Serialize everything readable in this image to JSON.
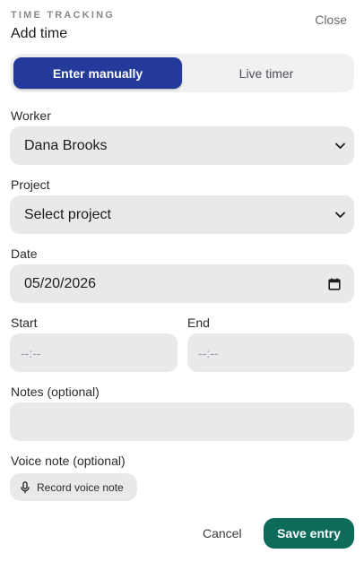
{
  "header": {
    "eyebrow": "TIME TRACKING",
    "title": "Add time",
    "close_label": "Close"
  },
  "mode_tabs": [
    {
      "label": "Enter manually",
      "active": true
    },
    {
      "label": "Live timer",
      "active": false
    }
  ],
  "form": {
    "worker": {
      "label": "Worker",
      "value": "Dana Brooks"
    },
    "project": {
      "label": "Project",
      "value": "Select project"
    },
    "date": {
      "label": "Date",
      "value": "05/20/2026"
    },
    "start": {
      "label": "Start",
      "value": "--:--"
    },
    "end": {
      "label": "End",
      "value": "--:--"
    },
    "notes": {
      "label": "Notes (optional)",
      "value": ""
    },
    "voice_note": {
      "label": "Voice note (optional)",
      "button_label": "Record voice note"
    }
  },
  "actions": {
    "cancel_label": "Cancel",
    "save_label": "Save entry"
  },
  "colors": {
    "active_tab": "#233a9b",
    "save_button": "#0d6b5a",
    "field_bg": "#e9e9eb"
  },
  "icons": {
    "worker_select": "chevron-down-icon",
    "project_select": "chevron-down-icon",
    "date_picker": "calendar-icon",
    "voice": "microphone-icon"
  }
}
